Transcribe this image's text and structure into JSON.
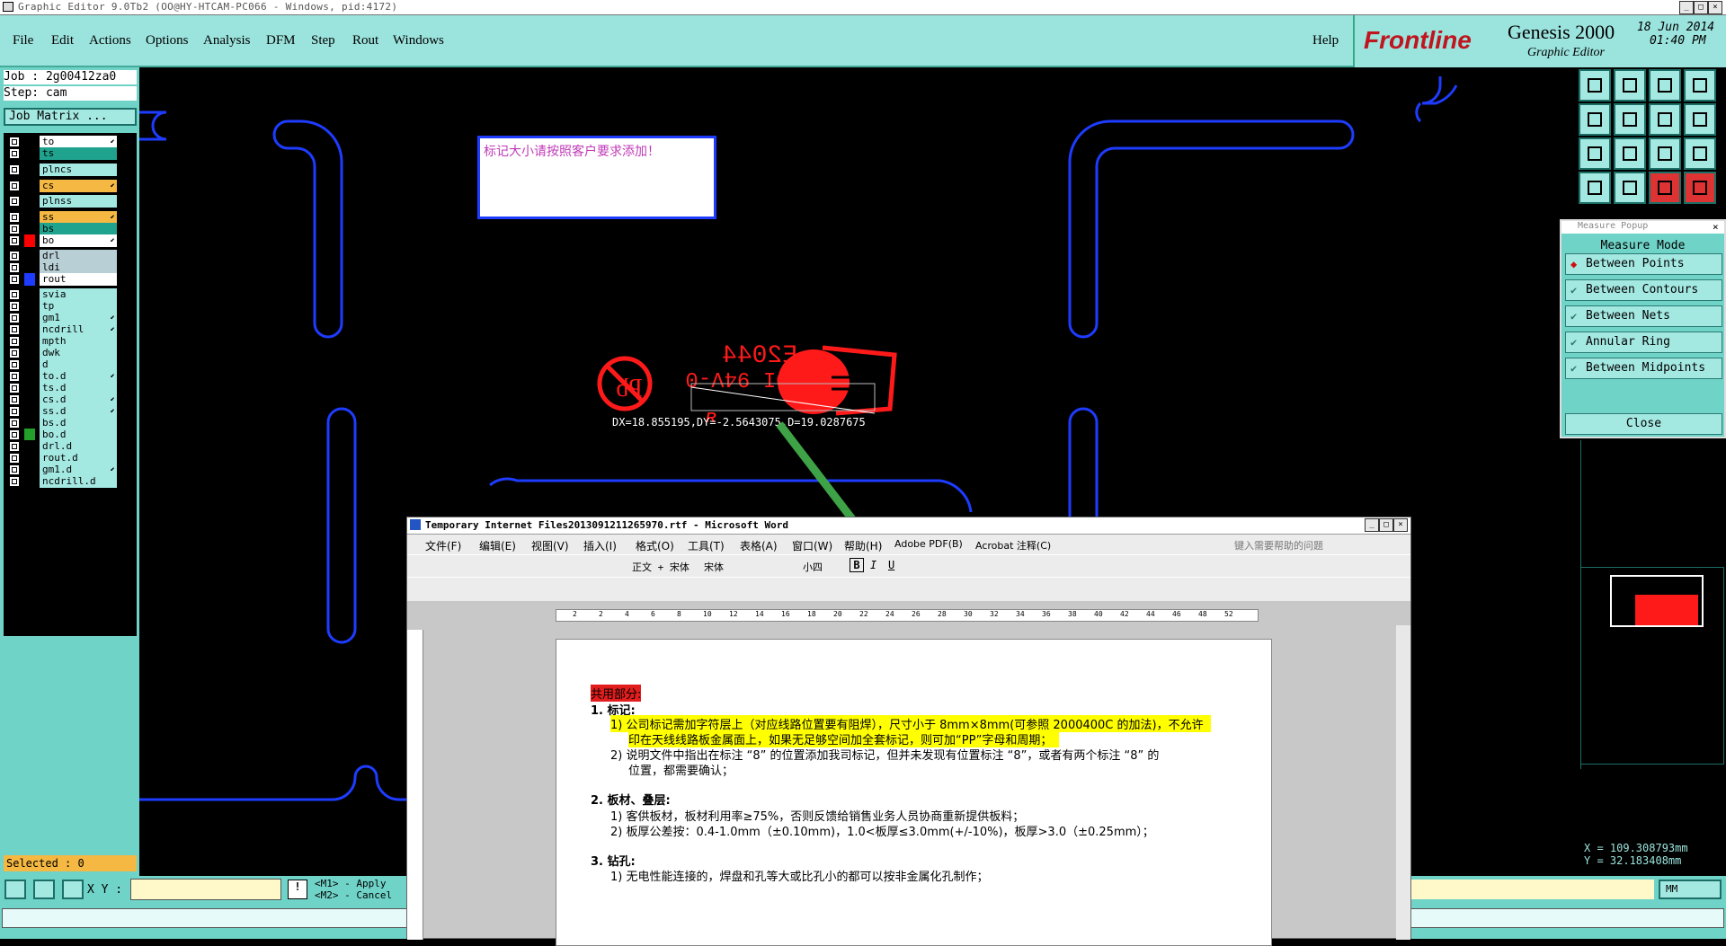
{
  "window": {
    "title": "Graphic Editor 9.0Tb2 (OO@HY-HTCAM-PC066 - Windows, pid:4172)"
  },
  "menu": [
    "File",
    "Edit",
    "Actions",
    "Options",
    "Analysis",
    "DFM",
    "Step",
    "Rout",
    "Windows"
  ],
  "help": "Help",
  "brand": {
    "logo": "Frontline",
    "product": "Genesis 2000",
    "subtitle": "Graphic Editor",
    "date": "18 Jun 2014",
    "time": "01:40 PM"
  },
  "job": {
    "job_label": "Job : 2g00412za0",
    "step_label": "Step: cam",
    "matrix_button": "Job Matrix ..."
  },
  "layers": [
    {
      "name": "to",
      "swatch": "#000",
      "bg": "#ffffff",
      "mark": true
    },
    {
      "name": "ts",
      "swatch": "#000",
      "bg": "#1fa38f",
      "mark": false
    },
    {
      "name": "plncs",
      "swatch": "#000",
      "bg": "#a4e8e2",
      "mark": false
    },
    {
      "name": "cs",
      "swatch": "#000",
      "bg": "#f4b843",
      "mark": true
    },
    {
      "name": "plnss",
      "swatch": "#000",
      "bg": "#a4e8e2",
      "mark": false
    },
    {
      "name": "ss",
      "swatch": "#000",
      "bg": "#f4b843",
      "mark": true
    },
    {
      "name": "bs",
      "swatch": "#000",
      "bg": "#1fa38f",
      "mark": false
    },
    {
      "name": "bo",
      "swatch": "#ff0000",
      "bg": "#ffffff",
      "mark": true
    },
    {
      "name": "drl",
      "swatch": "#000",
      "bg": "#b9cfd6",
      "mark": false
    },
    {
      "name": "ldi",
      "swatch": "#000",
      "bg": "#b9cfd6",
      "mark": false
    },
    {
      "name": "rout",
      "swatch": "#1e3cff",
      "bg": "#ffffff",
      "mark": false
    },
    {
      "name": "svia",
      "swatch": "#000",
      "bg": "#a4e8e2",
      "mark": false
    },
    {
      "name": "tp",
      "swatch": "#000",
      "bg": "#a4e8e2",
      "mark": false
    },
    {
      "name": "gm1",
      "swatch": "#000",
      "bg": "#a4e8e2",
      "mark": true
    },
    {
      "name": "ncdrill",
      "swatch": "#000",
      "bg": "#a4e8e2",
      "mark": true
    },
    {
      "name": "mpth",
      "swatch": "#000",
      "bg": "#a4e8e2",
      "mark": false
    },
    {
      "name": "dwk",
      "swatch": "#000",
      "bg": "#a4e8e2",
      "mark": false
    },
    {
      "name": "d",
      "swatch": "#000",
      "bg": "#a4e8e2",
      "mark": false
    },
    {
      "name": "to.d",
      "swatch": "#000",
      "bg": "#a4e8e2",
      "mark": true
    },
    {
      "name": "ts.d",
      "swatch": "#000",
      "bg": "#a4e8e2",
      "mark": false
    },
    {
      "name": "cs.d",
      "swatch": "#000",
      "bg": "#a4e8e2",
      "mark": true
    },
    {
      "name": "ss.d",
      "swatch": "#000",
      "bg": "#a4e8e2",
      "mark": true
    },
    {
      "name": "bs.d",
      "swatch": "#000",
      "bg": "#a4e8e2",
      "mark": false
    },
    {
      "name": "bo.d",
      "swatch": "#22a02a",
      "bg": "#a4e8e2",
      "mark": false
    },
    {
      "name": "drl.d",
      "swatch": "#000",
      "bg": "#a4e8e2",
      "mark": false
    },
    {
      "name": "rout.d",
      "swatch": "#000",
      "bg": "#a4e8e2",
      "mark": false
    },
    {
      "name": "gm1.d",
      "swatch": "#000",
      "bg": "#a4e8e2",
      "mark": true
    },
    {
      "name": "ncdrill.d",
      "swatch": "#000",
      "bg": "#a4e8e2",
      "mark": false
    }
  ],
  "selected": "Selected : 0",
  "canvas": {
    "note": "标记大小请按照客户要求添加！",
    "marking_top": "E2044",
    "marking_mid": "DI 94V-0",
    "measure_readout": "DX=18.855195,DY=-2.5643075,D=19.0287675"
  },
  "measure_popup": {
    "title": "Measure Popup",
    "mode_label": "Measure Mode",
    "options": [
      "Between Points",
      "Between Contours",
      "Between Nets",
      "Annular Ring",
      "Between Midpoints"
    ],
    "close": "Close"
  },
  "coords": {
    "x": "X = 109.308793mm",
    "y": "Y = 32.183408mm",
    "units": "MM"
  },
  "bottom": {
    "xy_label": "X Y :",
    "m1": "<M1> - Apply",
    "m2": "<M2> - Cancel"
  },
  "word": {
    "title": "Temporary Internet Files2013091211265970.rtf - Microsoft Word",
    "menus": [
      "文件(F)",
      "编辑(E)",
      "视图(V)",
      "插入(I)",
      "格式(O)",
      "工具(T)",
      "表格(A)",
      "窗口(W)",
      "帮助(H)",
      "Adobe PDF(B)",
      "Acrobat 注释(C)"
    ],
    "help_box": "键入需要帮助的问题",
    "style": "正文 + 宋体",
    "font": "宋体",
    "size": "小四",
    "ruler": [
      "2",
      "2",
      "4",
      "6",
      "8",
      "10",
      "12",
      "14",
      "16",
      "18",
      "20",
      "22",
      "24",
      "26",
      "28",
      "30",
      "32",
      "34",
      "36",
      "38",
      "40",
      "42",
      "44",
      "46",
      "48",
      "52"
    ],
    "lines": [
      "共用部分:",
      "1.  标记:",
      "1)  公司标记需加字符层上（对应线路位置要有阻焊），尺寸小于 8mm×8mm(可参照 2000400C 的加法)，不允许",
      "印在天线线路板金属面上，如果无足够空间加全套标记，则可加“PP”字母和周期；",
      "2)  说明文件中指出在标注 “8” 的位置添加我司标记，但并未发现有位置标注 “8”，或者有两个标注 “8” 的",
      "位置，都需要确认；",
      "2.  板材、叠层:",
      "1)  客供板材，板材利用率≥75%，否则反馈给销售业务人员协商重新提供板料；",
      "2)  板厚公差按：0.4-1.0mm（±0.10mm)，1.0<板厚≤3.0mm(+/-10%)，板厚>3.0（±0.25mm）；",
      "3.  钻孔:",
      "1)  无电性能连接的，焊盘和孔等大或比孔小的都可以按非金属化孔制作；"
    ]
  },
  "colors": {
    "teal": "#70d3c8",
    "light_teal": "#a4e8e2",
    "rout": "#1e3cff",
    "marking": "#ff1a1a",
    "arrow": "#3ea346"
  }
}
